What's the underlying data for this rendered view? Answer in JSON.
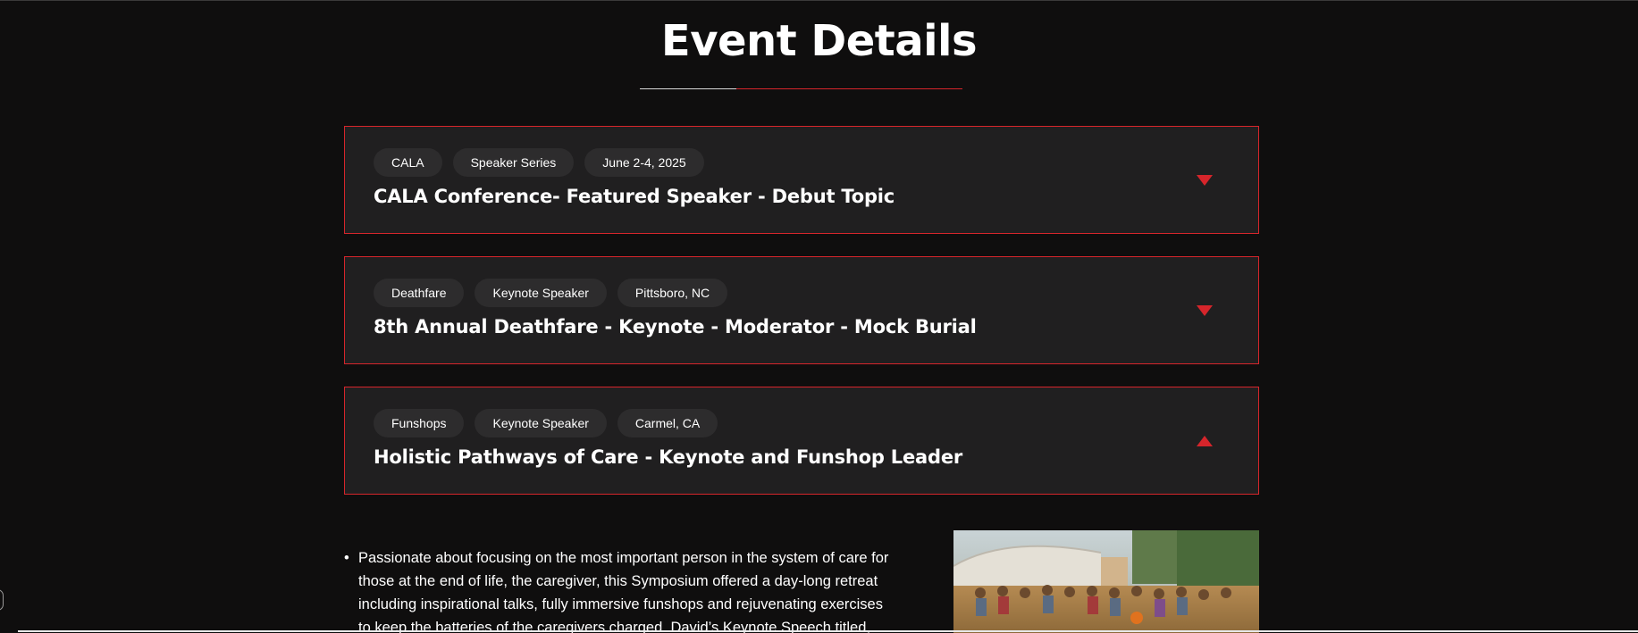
{
  "page": {
    "title": "Event Details"
  },
  "colors": {
    "background": "#0f0e0e",
    "card_background": "#201f20",
    "accent_red": "#d6252b",
    "tag_background": "#2d2c2d",
    "text": "#ffffff"
  },
  "events": [
    {
      "tags": [
        "CALA",
        "Speaker Series",
        "June 2-4, 2025"
      ],
      "title": "CALA Conference- Featured Speaker - Debut Topic",
      "toggle_icon": "caret-down-icon",
      "expanded": false
    },
    {
      "tags": [
        "Deathfare",
        "Keynote Speaker",
        "Pittsboro, NC"
      ],
      "title": "8th Annual Deathfare - Keynote - Moderator - Mock Burial",
      "toggle_icon": "caret-down-icon",
      "expanded": false
    },
    {
      "tags": [
        "Funshops",
        "Keynote Speaker",
        "Carmel, CA"
      ],
      "title": "Holistic Pathways of Care - Keynote and Funshop Leader",
      "toggle_icon": "caret-up-icon",
      "expanded": true
    }
  ],
  "expanded_content": {
    "bullets": [
      "Passionate about focusing on the most important person in the system of care for those at the end of life, the caregiver, this Symposium offered a day-long retreat including inspirational talks, fully immersive funshops and rejuvenating exercises to keep the batteries of the caregivers charged. David’s Keynote Speech titled, “Go Fly"
    ],
    "image_icon": "event-photo"
  }
}
